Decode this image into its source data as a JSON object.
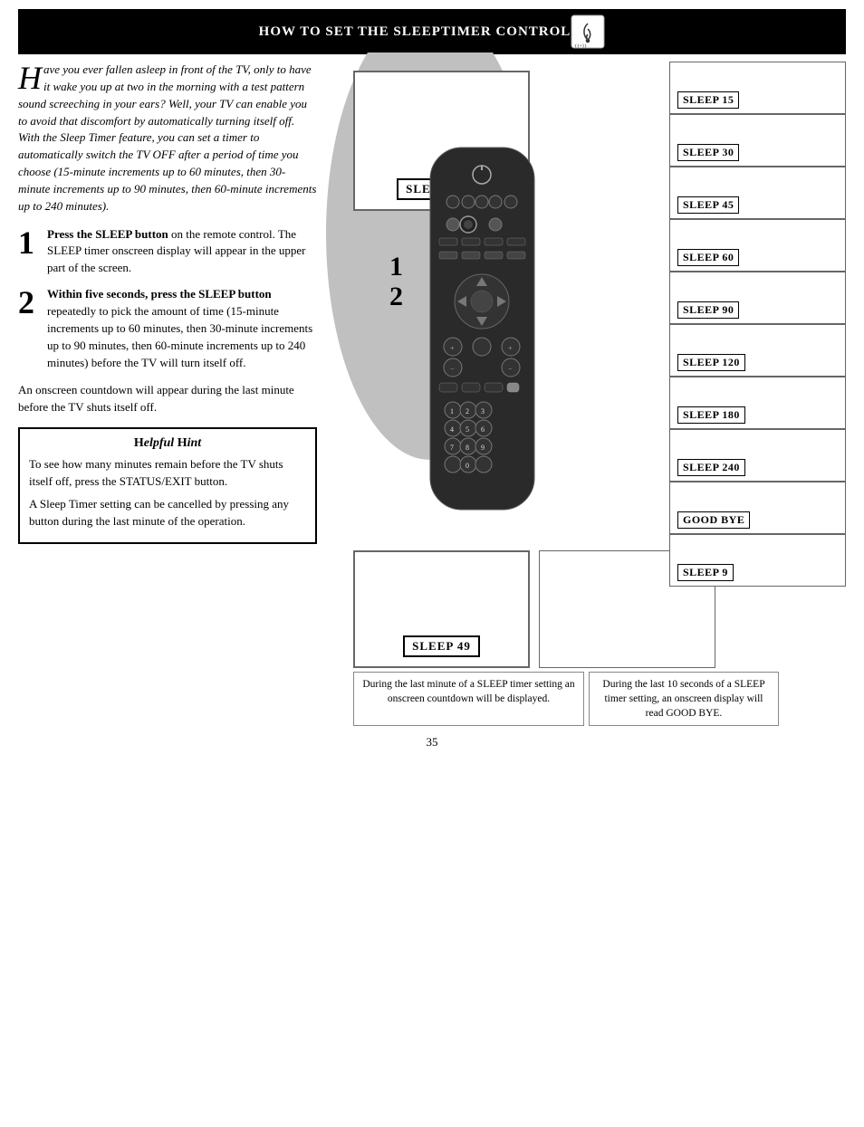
{
  "header": {
    "title": "How to set the Sleeptimer Control"
  },
  "intro": {
    "drop_cap": "H",
    "text": "ave you ever fallen asleep in front of the TV, only to have it wake you up at two in the morning with a test pattern sound screeching in your ears?  Well, your TV can enable you to avoid that discomfort by automatically turning itself off. With the Sleep Timer feature, you can set a timer to automatically switch the TV OFF after a period of time you choose (15-minute increments up to 60 minutes, then 30-minute increments up to 90 minutes, then 60-minute increments up to 240 minutes)."
  },
  "steps": [
    {
      "num": "1",
      "text_bold": "Press the SLEEP button",
      "text_rest": " on the remote control.  The SLEEP timer onscreen display will appear in the upper part of the screen."
    },
    {
      "num": "2",
      "text_bold": "Within five seconds, press the SLEEP button",
      "text_rest": " repeatedly to pick the amount of time (15-minute increments up to 60 minutes, then 30-minute increments up to 90 minutes, then 60-minute increments up to 240 minutes) before the TV will turn itself off."
    }
  ],
  "countdown_note": "An onscreen countdown will appear during the last minute before the TV shuts itself off.",
  "hint": {
    "title": "Helpful Hint",
    "paragraphs": [
      "To see how many minutes remain before the TV shuts itself off, press the STATUS/EXIT button.",
      "A Sleep Timer setting can be cancelled by pressing any button during the last minute of the operation."
    ]
  },
  "tv_screen": {
    "label": "SLEEP OFF"
  },
  "sleep_panels": [
    {
      "label": "SLEEP 15"
    },
    {
      "label": "SLEEP 30"
    },
    {
      "label": "SLEEP 45"
    },
    {
      "label": "SLEEP 60"
    },
    {
      "label": "SLEEP 90"
    },
    {
      "label": "SLEEP 120"
    },
    {
      "label": "SLEEP 180"
    },
    {
      "label": "SLEEP 240"
    },
    {
      "label": "GOOD BYE"
    },
    {
      "label": "SLEEP 9"
    }
  ],
  "bottom_screen": {
    "label": "SLEEP 49"
  },
  "captions": {
    "left": "During the last minute of a SLEEP timer setting an onscreen countdown will be displayed.",
    "right": "During the last 10 seconds of a SLEEP timer setting, an onscreen display will read GOOD BYE."
  },
  "page_number": "35"
}
